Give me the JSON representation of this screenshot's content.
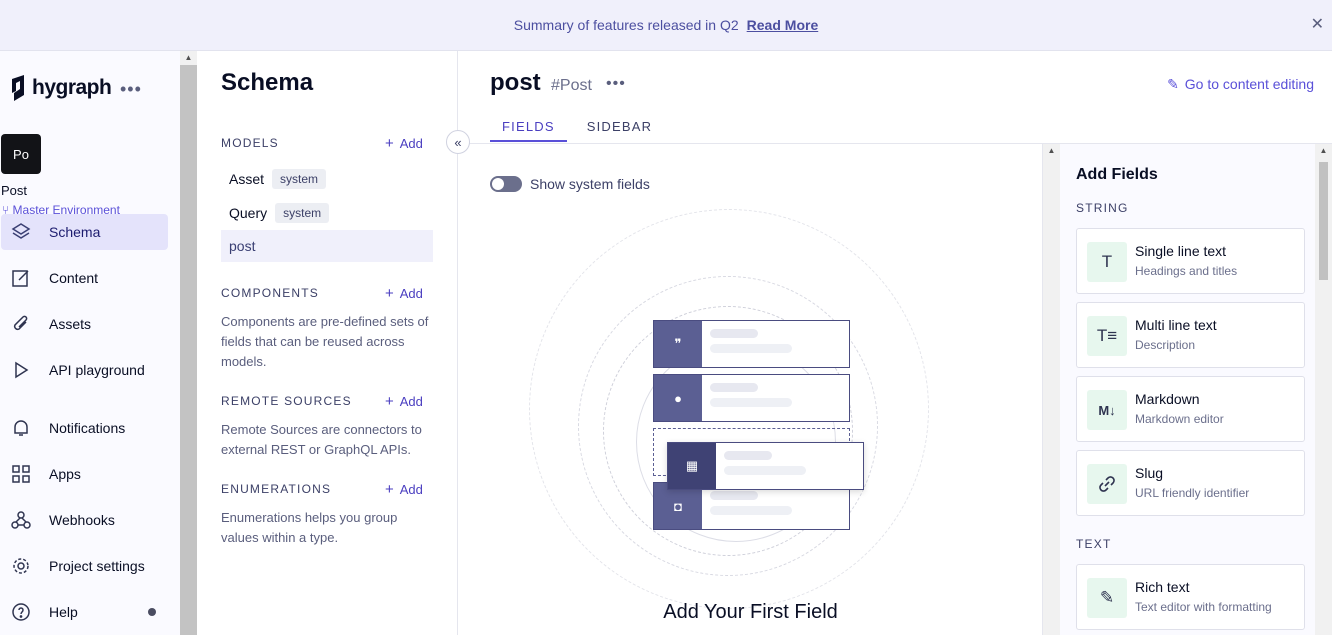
{
  "banner": {
    "text": "Summary of features released in Q2",
    "link": "Read More",
    "close": "✕"
  },
  "sidebar": {
    "logo": "hygraph",
    "more": "•••",
    "project": {
      "avatar": "Po",
      "name": "Post",
      "environment": "Master Environment"
    },
    "items": [
      {
        "label": "Schema",
        "icon": "layers-icon"
      },
      {
        "label": "Content",
        "icon": "edit-icon"
      },
      {
        "label": "Assets",
        "icon": "paperclip-icon"
      },
      {
        "label": "API playground",
        "icon": "play-icon"
      },
      {
        "label": "Notifications",
        "icon": "bell-icon"
      },
      {
        "label": "Apps",
        "icon": "apps-icon"
      },
      {
        "label": "Webhooks",
        "icon": "webhook-icon"
      },
      {
        "label": "Project settings",
        "icon": "gear-icon"
      },
      {
        "label": "Help",
        "icon": "help-icon"
      }
    ]
  },
  "schema": {
    "title": "Schema",
    "add": "Add",
    "models_title": "MODELS",
    "models": [
      {
        "name": "Asset",
        "badge": "system"
      },
      {
        "name": "Query",
        "badge": "system"
      },
      {
        "name": "post",
        "badge": ""
      }
    ],
    "components_title": "COMPONENTS",
    "components_desc": "Components are pre-defined sets of fields that can be reused across models.",
    "remote_title": "REMOTE SOURCES",
    "remote_desc": "Remote Sources are connectors to external REST or GraphQL APIs.",
    "enum_title": "ENUMERATIONS",
    "enum_desc": "Enumerations helps you group values within a type."
  },
  "main": {
    "model_name": "post",
    "model_api": "#Post",
    "more": "•••",
    "goto": "Go to content editing",
    "tabs": [
      "FIELDS",
      "SIDEBAR"
    ],
    "toggle_label": "Show system fields",
    "empty_title": "Add Your First Field"
  },
  "add_fields": {
    "title": "Add Fields",
    "string_title": "STRING",
    "text_title": "TEXT",
    "fields": [
      {
        "name": "Single line text",
        "desc": "Headings and titles",
        "icon": "T"
      },
      {
        "name": "Multi line text",
        "desc": "Description",
        "icon": "T≡"
      },
      {
        "name": "Markdown",
        "desc": "Markdown editor",
        "icon": "M↓"
      },
      {
        "name": "Slug",
        "desc": "URL friendly identifier",
        "icon": "🔗"
      },
      {
        "name": "Rich text",
        "desc": "Text editor with formatting",
        "icon": "✎"
      }
    ]
  },
  "colors": {
    "accent": "#5a50d8",
    "active_nav": "#e4e3fb",
    "banner": "#f0f0fb",
    "field_icon_bg": "#e7f7ee"
  }
}
